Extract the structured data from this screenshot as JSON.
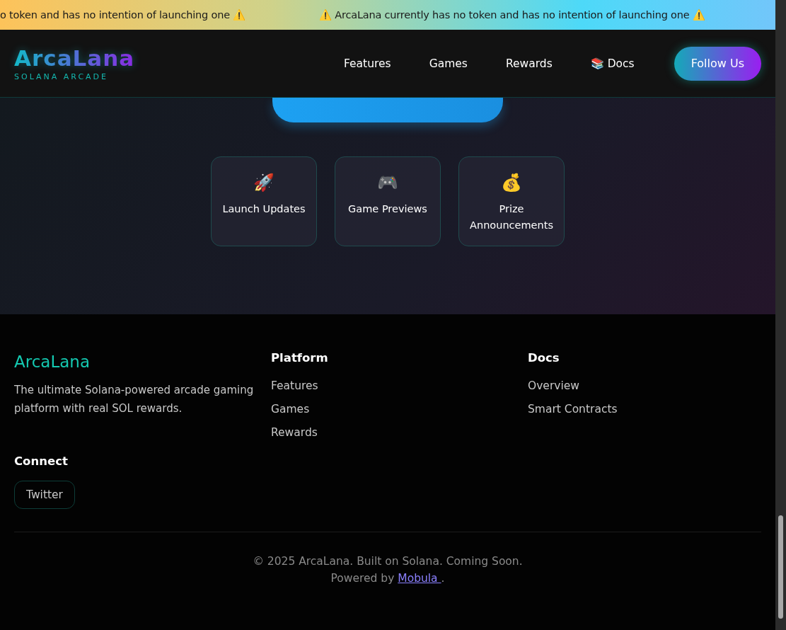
{
  "ticker": {
    "messages": [
      "o token and has no intention of launching one ⚠️",
      "⚠️ ArcaLana currently has no token and has no intention of launching one ⚠️"
    ]
  },
  "header": {
    "logo": "ArcaLana",
    "tagline": "SOLANA ARCADE",
    "nav": [
      {
        "label": "Features"
      },
      {
        "label": "Games"
      },
      {
        "label": "Rewards"
      },
      {
        "label": "📚 Docs"
      }
    ],
    "cta": "Follow Us"
  },
  "hero": {
    "follow_button": {
      "kind": "covered"
    },
    "cards": [
      {
        "icon": "🚀",
        "label": "Launch Updates"
      },
      {
        "icon": "🎮",
        "label": "Game Previews"
      },
      {
        "icon": "💰",
        "label": "Prize Announcements"
      }
    ]
  },
  "footer": {
    "brand": "ArcaLana",
    "description": "The ultimate Solana-powered arcade gaming platform with real SOL rewards.",
    "columns": [
      {
        "title": "Platform",
        "links": [
          "Features",
          "Games",
          "Rewards"
        ]
      },
      {
        "title": "Docs",
        "links": [
          "Overview",
          "Smart Contracts"
        ]
      }
    ],
    "connect": {
      "title": "Connect",
      "buttons": [
        "Twitter"
      ]
    },
    "copyright": "© 2025 ArcaLana. Built on Solana. Coming Soon.",
    "powered_by": {
      "text": "Powered by",
      "link": "Mobula ",
      "after": "."
    }
  }
}
